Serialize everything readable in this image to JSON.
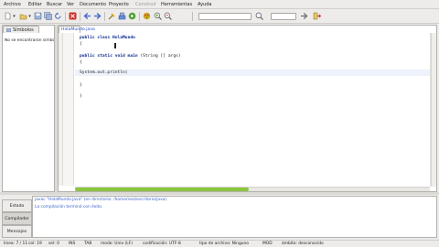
{
  "menubar": {
    "items": [
      {
        "label": "Archivo",
        "disabled": false
      },
      {
        "label": "Editar",
        "disabled": false
      },
      {
        "label": "Buscar",
        "disabled": false
      },
      {
        "label": "Ver",
        "disabled": false
      },
      {
        "label": "Documento",
        "disabled": false
      },
      {
        "label": "Proyecto",
        "disabled": false
      },
      {
        "label": "Construir",
        "disabled": true
      },
      {
        "label": "Herramientas",
        "disabled": false
      },
      {
        "label": "Ayuda",
        "disabled": false
      }
    ]
  },
  "toolbar": {
    "icons": [
      "new-file-icon",
      "open-file-icon",
      "save-icon",
      "save-all-icon",
      "revert-icon",
      "close-icon",
      "back-arrow-icon",
      "forward-arrow-icon",
      "compile-icon",
      "build-icon",
      "run-icon",
      "color-chooser-icon",
      "zoom-in-icon",
      "zoom-out-icon",
      "search-input",
      "jump-to-line-input",
      "quit-icon"
    ],
    "search_value": "",
    "goto_value": "",
    "colors": {
      "green": "#4f9f2f",
      "blue": "#3a63c7",
      "red": "#c9302c",
      "gold": "#d7a520"
    }
  },
  "sidebar": {
    "tab_label": "Símbolos",
    "message": "No se encontraron símbolos"
  },
  "editor": {
    "tab_label": "HolaMundo.java",
    "tab_close": "×",
    "code_lines": [
      [
        "public class ",
        "HolaMundo"
      ],
      [
        "{",
        ""
      ],
      [
        "",
        ""
      ],
      [
        "public static void main ",
        "(String [] args)"
      ],
      [
        "{",
        ""
      ],
      [
        "",
        ""
      ],
      [
        "System.out.println(",
        ""
      ],
      [
        "",
        ""
      ],
      [
        "}",
        ""
      ],
      [
        "",
        ""
      ],
      [
        "}",
        ""
      ]
    ]
  },
  "bottom": {
    "tabs": [
      "Estado",
      "Compilador",
      "Mensajes"
    ],
    "messages": [
      {
        "text": "javac \"HolaMundo.java\" (en directorio: /home/neo/escritorio/java)",
        "color": "#3a63c7"
      },
      {
        "text": "La compilación terminó con éxito.",
        "color": "#3a63c7"
      }
    ]
  },
  "statusbar": {
    "items": [
      "línea: 7 / 11",
      "col: 19",
      "sel: 0",
      "INS",
      "TAB",
      "modo: Unix (LF)",
      "codificación: UTF-8",
      "tipo de archivo: Ninguno",
      "MOD",
      "ámbito: desconocido"
    ]
  }
}
